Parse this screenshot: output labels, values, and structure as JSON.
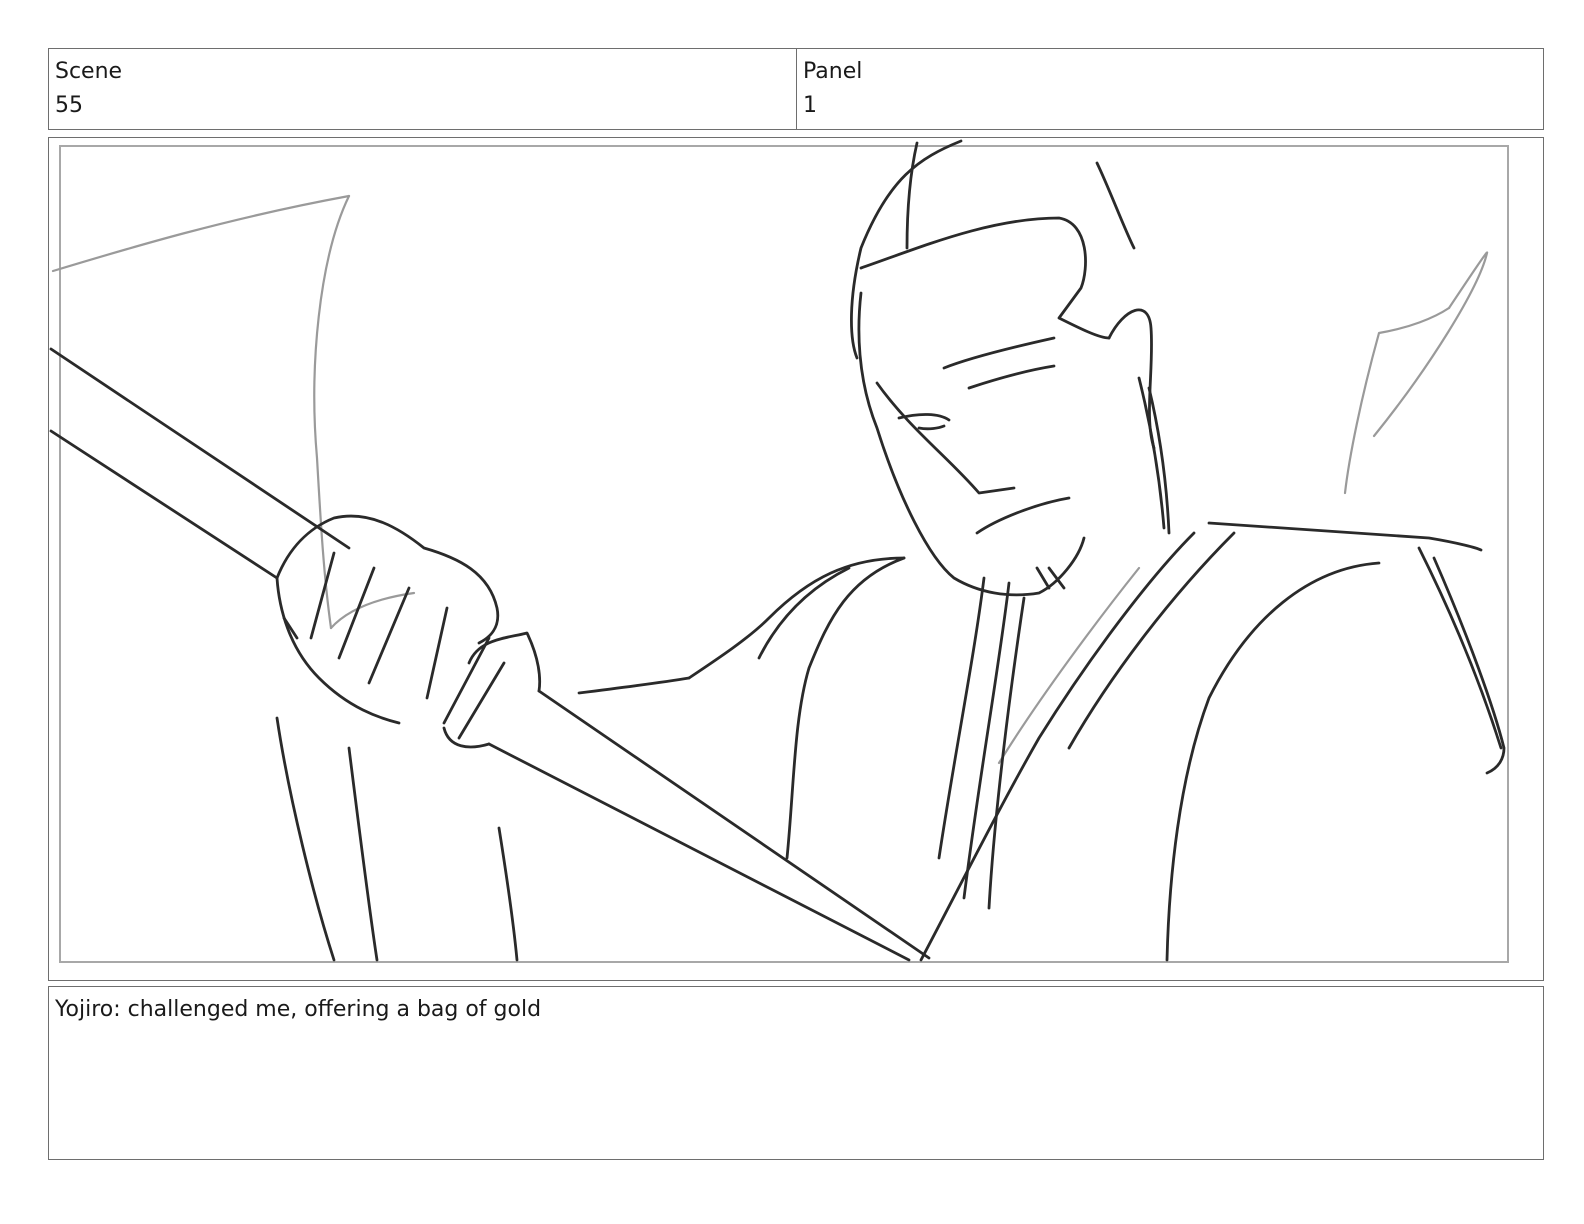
{
  "header": {
    "scene_label": "Scene",
    "scene_value": "55",
    "panel_label": "Panel",
    "panel_value": "1"
  },
  "notes": {
    "dialogue": "Yojiro: challenged me, offering a bag of gold"
  },
  "colors": {
    "border": "#6e6e6e",
    "sketch_dark": "#2a2a2a",
    "sketch_light": "#9a9a9a",
    "safe_frame": "#a8a8a8"
  }
}
